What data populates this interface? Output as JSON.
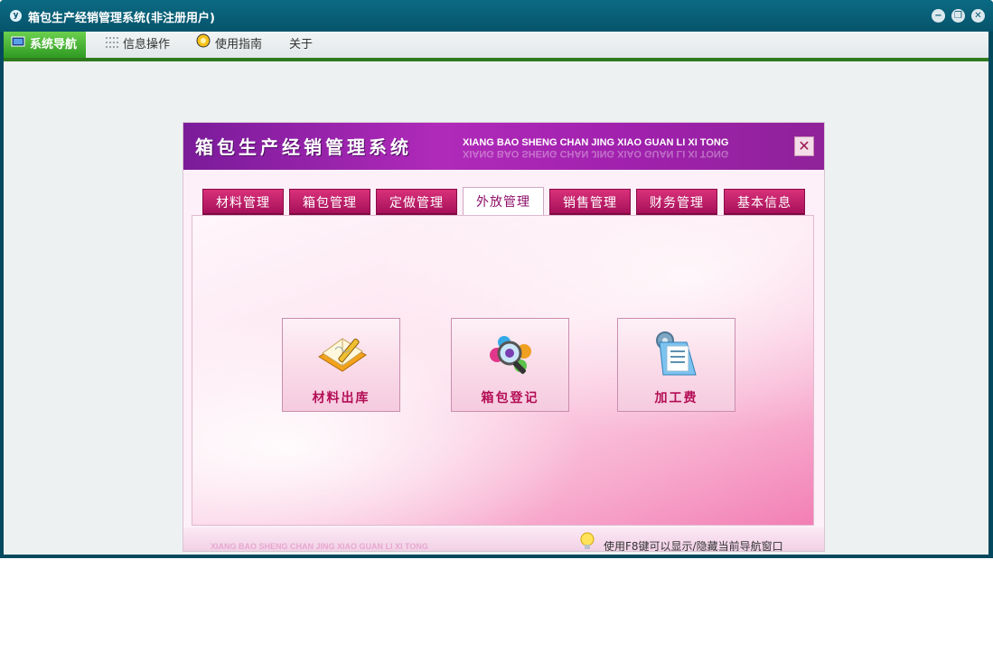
{
  "window": {
    "title": "箱包生产经销管理系统(非注册用户)"
  },
  "menu": {
    "items": [
      {
        "label": "系统导航",
        "icon": "monitor-icon",
        "active": true
      },
      {
        "label": "信息操作",
        "icon": "grid-icon",
        "active": false
      },
      {
        "label": "使用指南",
        "icon": "help-icon",
        "active": false
      },
      {
        "label": "关于",
        "icon": "",
        "active": false
      }
    ]
  },
  "panel": {
    "title": "箱包生产经销管理系统",
    "subtitle": "XIANG BAO SHENG CHAN JING XIAO GUAN LI XI TONG",
    "close_glyph": "✕",
    "tabs": [
      "材料管理",
      "箱包管理",
      "定做管理",
      "外放管理",
      "销售管理",
      "财务管理",
      "基本信息"
    ],
    "active_tab": "外放管理",
    "functions": [
      {
        "label": "材料出库",
        "icon": "notebook-pencil-icon"
      },
      {
        "label": "箱包登记",
        "icon": "magnifier-icon"
      },
      {
        "label": "加工费",
        "icon": "clipboard-gear-icon"
      }
    ],
    "footer_subtitle": "XIANG BAO SHENG CHAN JING XIAO GUAN LI XI TONG",
    "footer_hint": "使用F8键可以显示/隐藏当前导航窗口"
  },
  "colors": {
    "titlebar": "#06546b",
    "menu_active": "#2f9a23",
    "panel_header": "#a021ad",
    "tab": "#c21a68",
    "function_label": "#b30d55"
  }
}
